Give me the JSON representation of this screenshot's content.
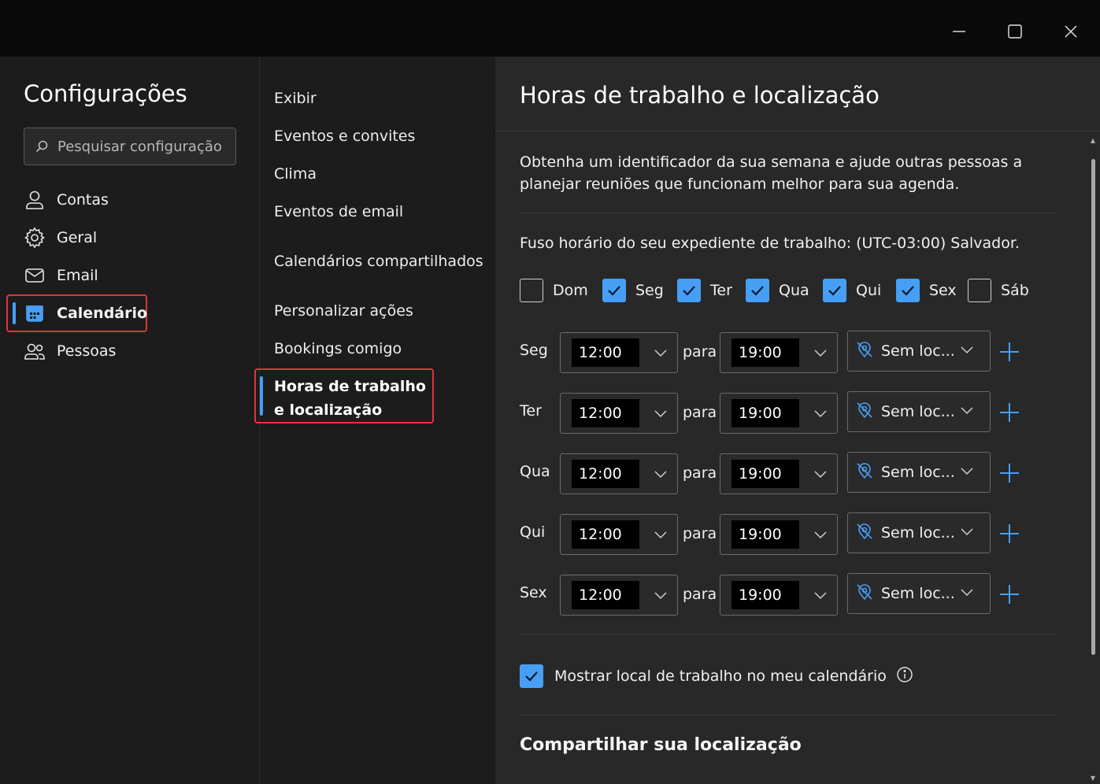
{
  "window": {
    "controls": [
      "minimize",
      "maximize",
      "close"
    ]
  },
  "nav": {
    "title": "Configurações",
    "search_placeholder": "Pesquisar configuração",
    "items": [
      {
        "label": "Contas",
        "icon": "person-icon"
      },
      {
        "label": "Geral",
        "icon": "gear-icon"
      },
      {
        "label": "Email",
        "icon": "mail-icon"
      },
      {
        "label": "Calendário",
        "icon": "calendar-icon",
        "selected": true
      },
      {
        "label": "Pessoas",
        "icon": "people-icon"
      }
    ]
  },
  "subnav": {
    "items": [
      {
        "label": "Exibir"
      },
      {
        "label": "Eventos e convites"
      },
      {
        "label": "Clima"
      },
      {
        "label": "Eventos de email"
      },
      {
        "label": "Calendários compartilhados"
      },
      {
        "label": "Personalizar ações"
      },
      {
        "label": "Bookings comigo"
      },
      {
        "label": "Horas de trabalho e localização",
        "selected": true
      }
    ]
  },
  "content": {
    "title": "Horas de trabalho e localização",
    "description": "Obtenha um identificador da sua semana e ajude outras pessoas a planejar reuniões que funcionam melhor para sua agenda.",
    "timezone": "Fuso horário do seu expediente de trabalho: (UTC-03:00) Salvador.",
    "days": [
      {
        "label": "Dom",
        "checked": false
      },
      {
        "label": "Seg",
        "checked": true
      },
      {
        "label": "Ter",
        "checked": true
      },
      {
        "label": "Qua",
        "checked": true
      },
      {
        "label": "Qui",
        "checked": true
      },
      {
        "label": "Sex",
        "checked": true
      },
      {
        "label": "Sáb",
        "checked": false
      }
    ],
    "connector": "para",
    "schedule": [
      {
        "day": "Seg",
        "start": "12:00",
        "end": "19:00",
        "location": "Sem loc..."
      },
      {
        "day": "Ter",
        "start": "12:00",
        "end": "19:00",
        "location": "Sem loc..."
      },
      {
        "day": "Qua",
        "start": "12:00",
        "end": "19:00",
        "location": "Sem loc..."
      },
      {
        "day": "Qui",
        "start": "12:00",
        "end": "19:00",
        "location": "Sem loc..."
      },
      {
        "day": "Sex",
        "start": "12:00",
        "end": "19:00",
        "location": "Sem loc..."
      }
    ],
    "show_location_label": "Mostrar local de trabalho no meu calendário",
    "show_location_checked": true,
    "share_title": "Compartilhar sua localização"
  },
  "colors": {
    "accent": "#479ef5",
    "highlight": "#e0333a"
  }
}
